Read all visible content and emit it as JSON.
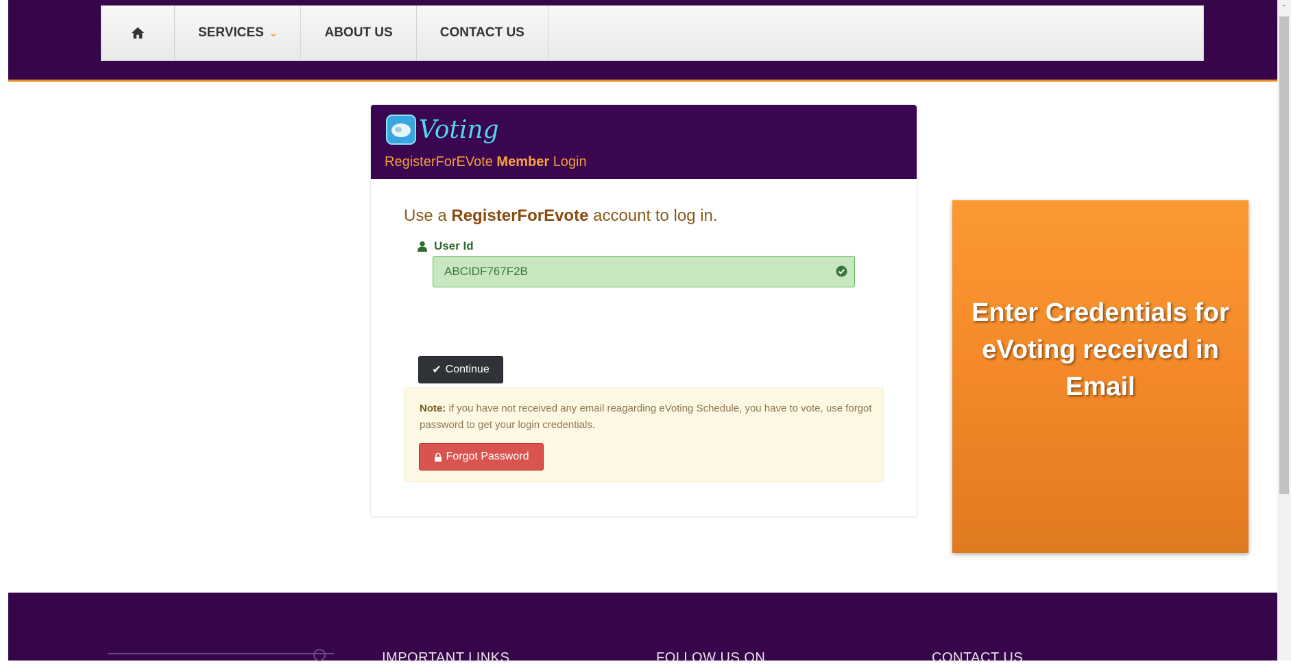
{
  "nav": {
    "items": [
      {
        "label": "SERVICES"
      },
      {
        "label": "ABOUT US"
      },
      {
        "label": "CONTACT US"
      }
    ],
    "home_icon": "home-icon",
    "dropdown_icon": "chevron-down-icon"
  },
  "panel": {
    "logo_text": "Voting",
    "title_prefix": "RegisterForEVote",
    "title_bold": "Member",
    "title_suffix": "Login",
    "lead_prefix": "Use a",
    "lead_bold": "RegisterForEvote",
    "lead_suffix": "account to log in.",
    "user_id_label": "User Id",
    "user_id_value": "ABCIDF767F2B",
    "continue_label": "Continue",
    "note_bold": "Note:",
    "note_text": "if you have not received any email reagarding eVoting Schedule, you have to vote, use forgot password to get your login credentials.",
    "forgot_label": "Forgot Password"
  },
  "callout": {
    "text": "Enter Credentials for eVoting received in Email"
  },
  "footer": {
    "headings": [
      "IMPORTANT LINKS",
      "FOLLOW US ON",
      "CONTACT US"
    ]
  },
  "colors": {
    "brand_purple": "#37064a",
    "accent_orange": "#f08c1e",
    "success_green": "#5cb85c",
    "danger_red": "#d9534f"
  }
}
